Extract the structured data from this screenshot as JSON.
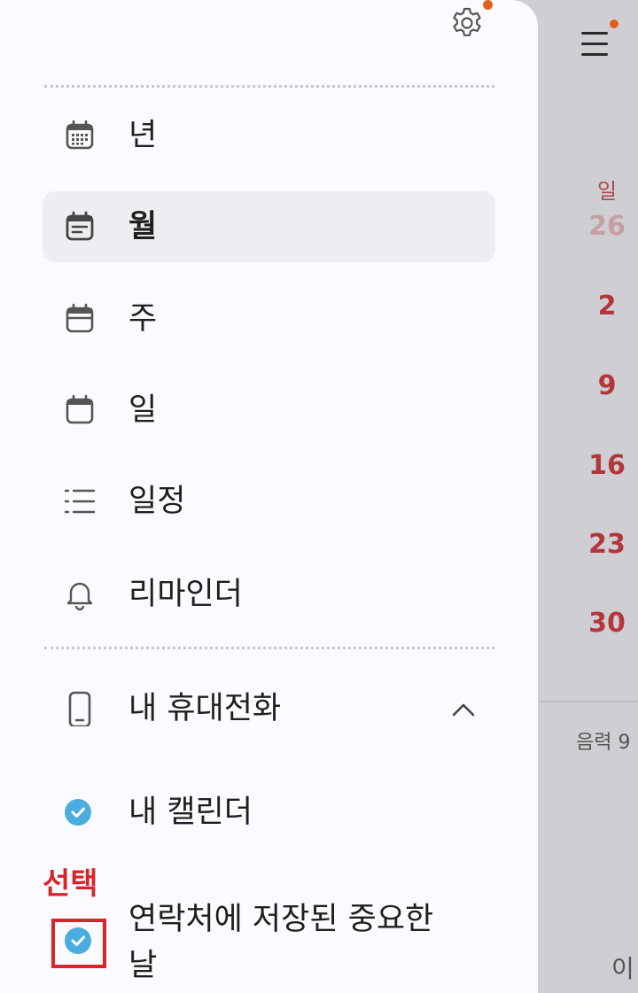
{
  "background_calendar": {
    "day_header": "일",
    "dates": [
      "26",
      "2",
      "9",
      "16",
      "23",
      "30"
    ],
    "lunar_text": "음력 9",
    "bottom_text": "이"
  },
  "drawer": {
    "nav_items": [
      {
        "label": "년",
        "icon": "year-calendar-icon"
      },
      {
        "label": "월",
        "icon": "month-calendar-icon",
        "selected": true
      },
      {
        "label": "주",
        "icon": "week-calendar-icon"
      },
      {
        "label": "일",
        "icon": "day-calendar-icon"
      },
      {
        "label": "일정",
        "icon": "list-icon"
      },
      {
        "label": "리마인더",
        "icon": "bell-icon"
      }
    ],
    "section": {
      "label": "내 휴대전화",
      "icon": "phone-icon",
      "expanded": true
    },
    "calendars": [
      {
        "label": "내 캘린더",
        "checked": true
      },
      {
        "label_line1": "연락처에 저장된 중요한",
        "label_line2": "날",
        "checked": true
      }
    ]
  },
  "annotation": {
    "label": "선택",
    "color": "#d6262b"
  },
  "colors": {
    "accent": "#4bacdf",
    "badge": "#e0601b",
    "sunday": "#b3363b"
  }
}
